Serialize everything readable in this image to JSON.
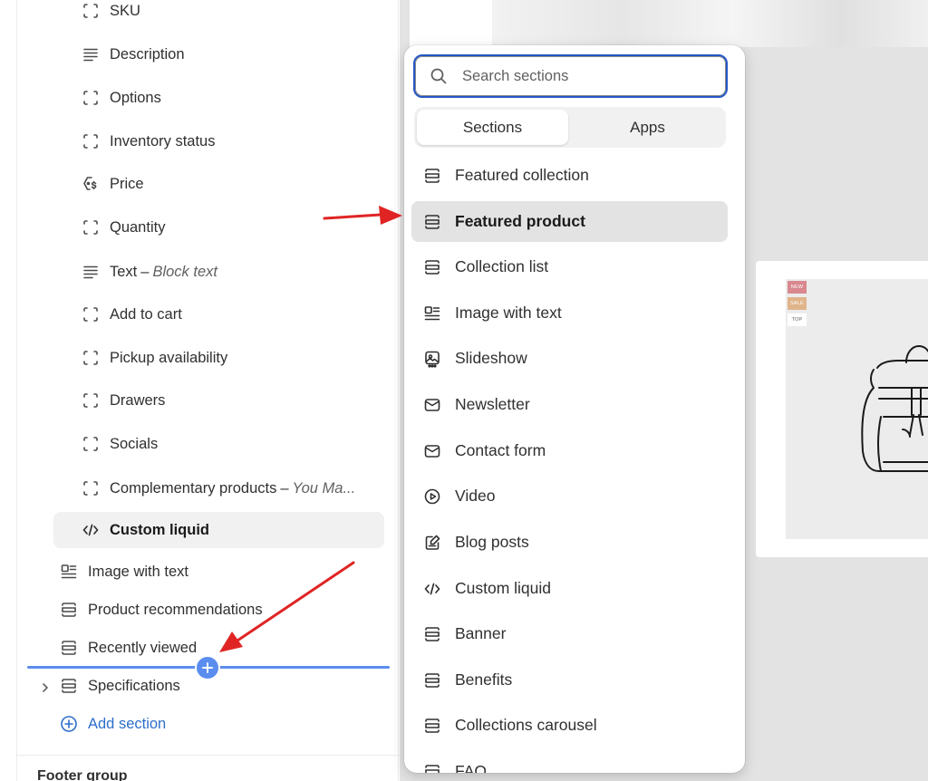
{
  "sidebar": {
    "blocks": [
      {
        "label": "SKU",
        "icon": "block-icon"
      },
      {
        "label": "Description",
        "icon": "text-lines-icon"
      },
      {
        "label": "Options",
        "icon": "block-icon"
      },
      {
        "label": "Inventory status",
        "icon": "block-icon"
      },
      {
        "label": "Price",
        "icon": "price-tag-icon"
      },
      {
        "label": "Quantity",
        "icon": "block-icon"
      },
      {
        "label": "Text",
        "suffix": "Block text",
        "icon": "text-lines-icon"
      },
      {
        "label": "Add to cart",
        "icon": "block-icon"
      },
      {
        "label": "Pickup availability",
        "icon": "block-icon"
      },
      {
        "label": "Drawers",
        "icon": "block-icon"
      },
      {
        "label": "Socials",
        "icon": "block-icon"
      },
      {
        "label": "Complementary products",
        "suffix": "You Ma...",
        "icon": "block-icon"
      },
      {
        "label": "Custom liquid",
        "icon": "code-icon",
        "selected": true
      }
    ],
    "sections": [
      {
        "label": "Image with text",
        "icon": "image-text-icon"
      },
      {
        "label": "Product recommendations",
        "icon": "section-icon"
      },
      {
        "label": "Recently viewed",
        "icon": "section-icon"
      },
      {
        "label": "Specifications",
        "icon": "section-icon",
        "collapsed": true
      }
    ],
    "add_section_label": "Add section",
    "footer_group_label": "Footer group",
    "dash": "–"
  },
  "picker": {
    "search": {
      "placeholder": "Search sections",
      "value": ""
    },
    "tabs": [
      {
        "label": "Sections",
        "active": true
      },
      {
        "label": "Apps",
        "active": false
      }
    ],
    "items": [
      {
        "label": "Featured collection",
        "icon": "section-icon"
      },
      {
        "label": "Featured product",
        "icon": "section-icon",
        "selected": true
      },
      {
        "label": "Collection list",
        "icon": "section-icon"
      },
      {
        "label": "Image with text",
        "icon": "image-text-icon"
      },
      {
        "label": "Slideshow",
        "icon": "slideshow-icon"
      },
      {
        "label": "Newsletter",
        "icon": "envelope-icon"
      },
      {
        "label": "Contact form",
        "icon": "envelope-icon"
      },
      {
        "label": "Video",
        "icon": "play-icon"
      },
      {
        "label": "Blog posts",
        "icon": "blog-icon"
      },
      {
        "label": "Custom liquid",
        "icon": "code-icon"
      },
      {
        "label": "Banner",
        "icon": "section-icon"
      },
      {
        "label": "Benefits",
        "icon": "section-icon"
      },
      {
        "label": "Collections carousel",
        "icon": "section-icon"
      },
      {
        "label": "FAQ",
        "icon": "section-icon"
      }
    ]
  },
  "preview": {
    "badges": [
      {
        "label": "NEW",
        "color": "#d9888f"
      },
      {
        "label": "SALE",
        "color": "#e0b48a"
      },
      {
        "label": "TOP",
        "color": "#ffffff"
      }
    ]
  },
  "colors": {
    "accent_blue": "#2457c5",
    "insert_line": "#5b8def",
    "link_blue": "#2c6ecb",
    "arrow_red": "#e02424"
  }
}
